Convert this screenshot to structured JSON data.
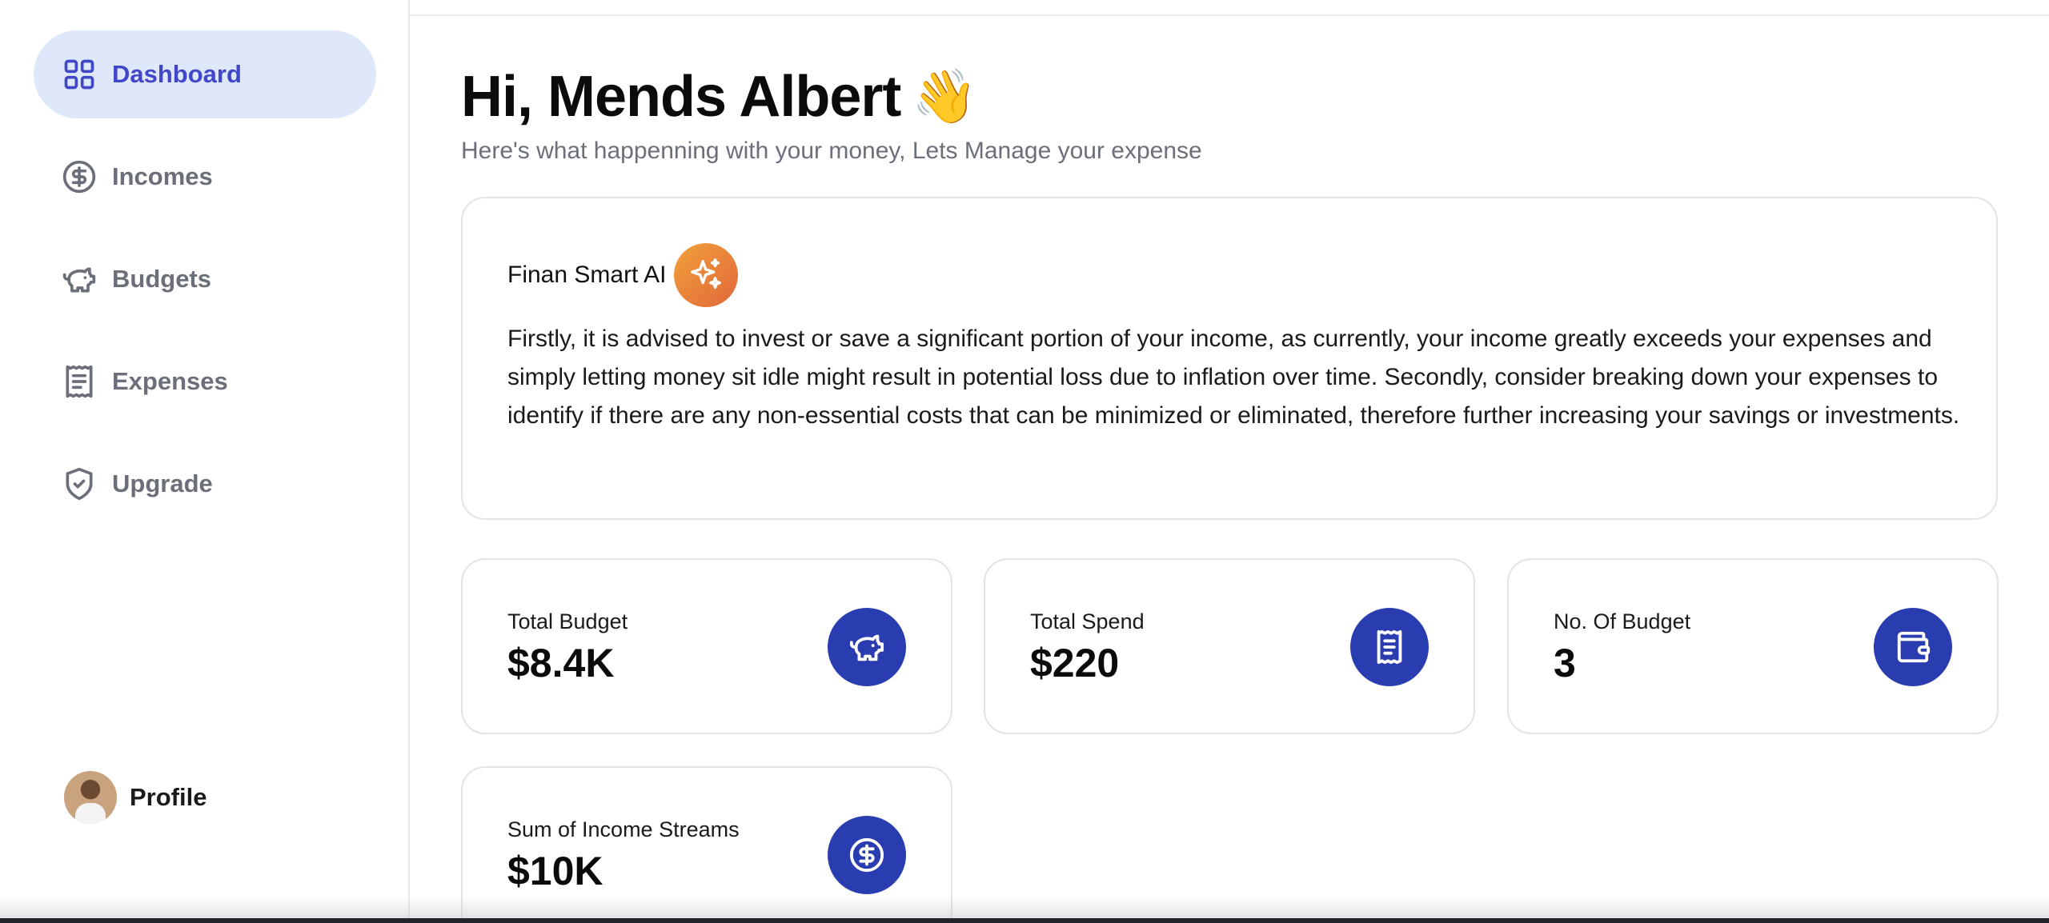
{
  "sidebar": {
    "items": [
      {
        "label": "Dashboard",
        "icon": "dashboard-grid-icon",
        "active": true
      },
      {
        "label": "Incomes",
        "icon": "dollar-circle-icon",
        "active": false
      },
      {
        "label": "Budgets",
        "icon": "piggy-bank-icon",
        "active": false
      },
      {
        "label": "Expenses",
        "icon": "receipt-icon",
        "active": false
      },
      {
        "label": "Upgrade",
        "icon": "shield-check-icon",
        "active": false
      }
    ],
    "profile_label": "Profile"
  },
  "header": {
    "greeting": "Hi, Mends Albert",
    "wave_emoji": "👋",
    "subtitle": "Here's what happenning with your money, Lets Manage your expense"
  },
  "ai_card": {
    "title": "Finan Smart AI",
    "icon": "sparkles-icon",
    "text": "Firstly, it is advised to invest or save a significant portion of your income, as currently, your income greatly exceeds your expenses and simply letting money sit idle might result in potential loss due to inflation over time. Secondly, consider breaking down your expenses to identify if there are any non-essential costs that can be minimized or eliminated, therefore further increasing your savings or investments."
  },
  "stats": [
    {
      "label": "Total Budget",
      "value": "$8.4K",
      "icon": "piggy-bank-icon"
    },
    {
      "label": "Total Spend",
      "value": "$220",
      "icon": "receipt-icon"
    },
    {
      "label": "No. Of Budget",
      "value": "3",
      "icon": "wallet-icon"
    },
    {
      "label": "Sum of Income Streams",
      "value": "$10K",
      "icon": "dollar-circle-icon"
    }
  ],
  "colors": {
    "accent": "#4147c9",
    "active_bg": "#dfe8fa",
    "stat_icon_bg": "#2a3db0",
    "ai_badge_start": "#f2a03a",
    "ai_badge_end": "#e0683a",
    "muted_text": "#6b6f7a"
  }
}
